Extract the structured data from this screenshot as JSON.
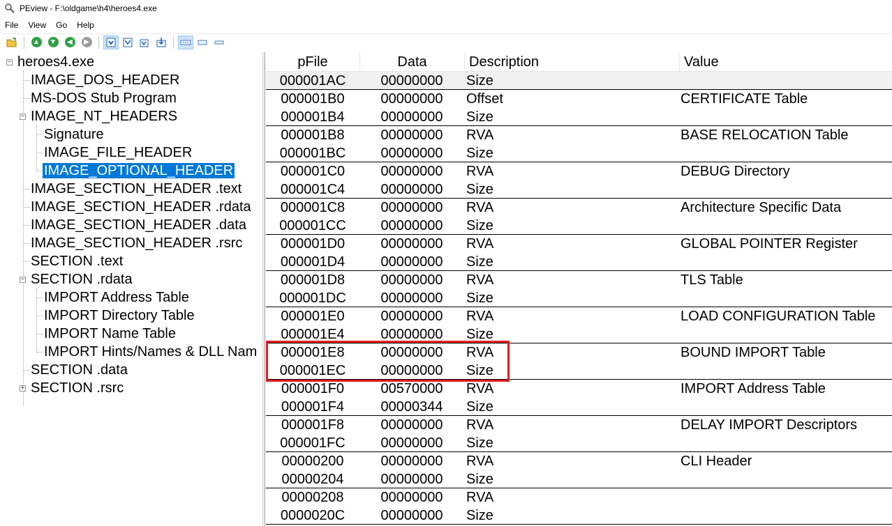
{
  "window": {
    "title": "PEview - F:\\oldgame\\h4\\heroes4.exe"
  },
  "menu": [
    "File",
    "View",
    "Go",
    "Help"
  ],
  "toolbar": {
    "icons": [
      "open-file-icon",
      "go-top-icon",
      "go-bottom-icon",
      "go-back-icon",
      "go-forward-icon",
      "view-byte-icon",
      "view-word-icon",
      "view-dword-icon",
      "view-qword-icon",
      "view-details-icon",
      "view-small-icon",
      "view-wide-icon"
    ]
  },
  "tree": {
    "items": [
      {
        "label": "heroes4.exe",
        "level": 0,
        "expander": "minus"
      },
      {
        "label": "IMAGE_DOS_HEADER",
        "level": 1
      },
      {
        "label": "MS-DOS Stub Program",
        "level": 1
      },
      {
        "label": "IMAGE_NT_HEADERS",
        "level": 1,
        "expander": "minus"
      },
      {
        "label": "Signature",
        "level": 2
      },
      {
        "label": "IMAGE_FILE_HEADER",
        "level": 2
      },
      {
        "label": "IMAGE_OPTIONAL_HEADER",
        "level": 2,
        "selected": true
      },
      {
        "label": "IMAGE_SECTION_HEADER .text",
        "level": 1
      },
      {
        "label": "IMAGE_SECTION_HEADER .rdata",
        "level": 1
      },
      {
        "label": "IMAGE_SECTION_HEADER .data",
        "level": 1
      },
      {
        "label": "IMAGE_SECTION_HEADER .rsrc",
        "level": 1
      },
      {
        "label": "SECTION .text",
        "level": 1
      },
      {
        "label": "SECTION .rdata",
        "level": 1,
        "expander": "minus"
      },
      {
        "label": "IMPORT Address Table",
        "level": 2
      },
      {
        "label": "IMPORT Directory Table",
        "level": 2
      },
      {
        "label": "IMPORT Name Table",
        "level": 2
      },
      {
        "label": "IMPORT Hints/Names & DLL Nam",
        "level": 2
      },
      {
        "label": "SECTION .data",
        "level": 1
      },
      {
        "label": "SECTION .rsrc",
        "level": 1,
        "expander": "plus"
      }
    ]
  },
  "list": {
    "columns": [
      "pFile",
      "Data",
      "Description",
      "Value"
    ],
    "rows": [
      {
        "pfile": "000001AC",
        "data": "00000000",
        "desc": "Size",
        "value": ""
      },
      {
        "pfile": "000001B0",
        "data": "00000000",
        "desc": "Offset",
        "value": "CERTIFICATE Table"
      },
      {
        "pfile": "000001B4",
        "data": "00000000",
        "desc": "Size",
        "value": ""
      },
      {
        "pfile": "000001B8",
        "data": "00000000",
        "desc": "RVA",
        "value": "BASE RELOCATION Table"
      },
      {
        "pfile": "000001BC",
        "data": "00000000",
        "desc": "Size",
        "value": ""
      },
      {
        "pfile": "000001C0",
        "data": "00000000",
        "desc": "RVA",
        "value": "DEBUG Directory"
      },
      {
        "pfile": "000001C4",
        "data": "00000000",
        "desc": "Size",
        "value": ""
      },
      {
        "pfile": "000001C8",
        "data": "00000000",
        "desc": "RVA",
        "value": "Architecture Specific Data"
      },
      {
        "pfile": "000001CC",
        "data": "00000000",
        "desc": "Size",
        "value": ""
      },
      {
        "pfile": "000001D0",
        "data": "00000000",
        "desc": "RVA",
        "value": "GLOBAL POINTER Register"
      },
      {
        "pfile": "000001D4",
        "data": "00000000",
        "desc": "Size",
        "value": ""
      },
      {
        "pfile": "000001D8",
        "data": "00000000",
        "desc": "RVA",
        "value": "TLS Table"
      },
      {
        "pfile": "000001DC",
        "data": "00000000",
        "desc": "Size",
        "value": ""
      },
      {
        "pfile": "000001E0",
        "data": "00000000",
        "desc": "RVA",
        "value": "LOAD CONFIGURATION Table"
      },
      {
        "pfile": "000001E4",
        "data": "00000000",
        "desc": "Size",
        "value": ""
      },
      {
        "pfile": "000001E8",
        "data": "00000000",
        "desc": "RVA",
        "value": "BOUND IMPORT Table"
      },
      {
        "pfile": "000001EC",
        "data": "00000000",
        "desc": "Size",
        "value": ""
      },
      {
        "pfile": "000001F0",
        "data": "00570000",
        "desc": "RVA",
        "value": "IMPORT Address Table"
      },
      {
        "pfile": "000001F4",
        "data": "00000344",
        "desc": "Size",
        "value": ""
      },
      {
        "pfile": "000001F8",
        "data": "00000000",
        "desc": "RVA",
        "value": "DELAY IMPORT Descriptors"
      },
      {
        "pfile": "000001FC",
        "data": "00000000",
        "desc": "Size",
        "value": ""
      },
      {
        "pfile": "00000200",
        "data": "00000000",
        "desc": "RVA",
        "value": "CLI Header"
      },
      {
        "pfile": "00000204",
        "data": "00000000",
        "desc": "Size",
        "value": ""
      },
      {
        "pfile": "00000208",
        "data": "00000000",
        "desc": "RVA",
        "value": ""
      },
      {
        "pfile": "0000020C",
        "data": "00000000",
        "desc": "Size",
        "value": ""
      }
    ]
  },
  "colors": {
    "selection": "#0078d7",
    "highlight_box": "#e0201f"
  }
}
